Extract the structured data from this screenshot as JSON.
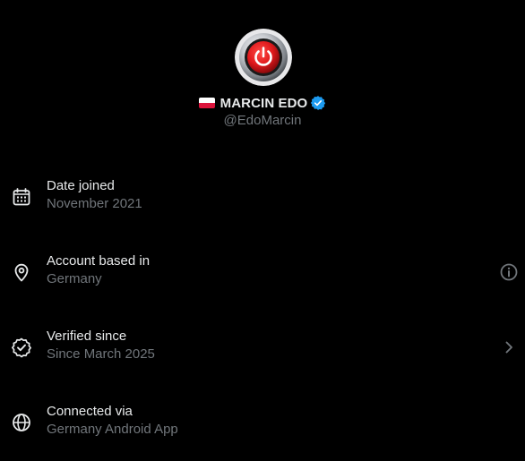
{
  "profile": {
    "display_name": "MARCIN EDO",
    "handle": "@EdoMarcin",
    "flag_icon": "poland-flag-icon",
    "verified_icon": "verified-badge-icon",
    "verified_color": "#1d9bf0",
    "avatar_icon": "power-button-icon",
    "avatar_color": "#e0191c"
  },
  "rows": [
    {
      "icon": "calendar-icon",
      "label": "Date joined",
      "value": "November 2021"
    },
    {
      "icon": "location-pin-icon",
      "label": "Account based in",
      "value": "Germany",
      "action_icon": "info-icon"
    },
    {
      "icon": "verified-check-icon",
      "label": "Verified since",
      "value": "Since March 2025",
      "action_icon": "chevron-right-icon"
    },
    {
      "icon": "globe-icon",
      "label": "Connected via",
      "value": "Germany Android App"
    }
  ],
  "colors": {
    "background": "#000000",
    "primary_text": "#e7e9ea",
    "secondary_text": "#71767b"
  }
}
